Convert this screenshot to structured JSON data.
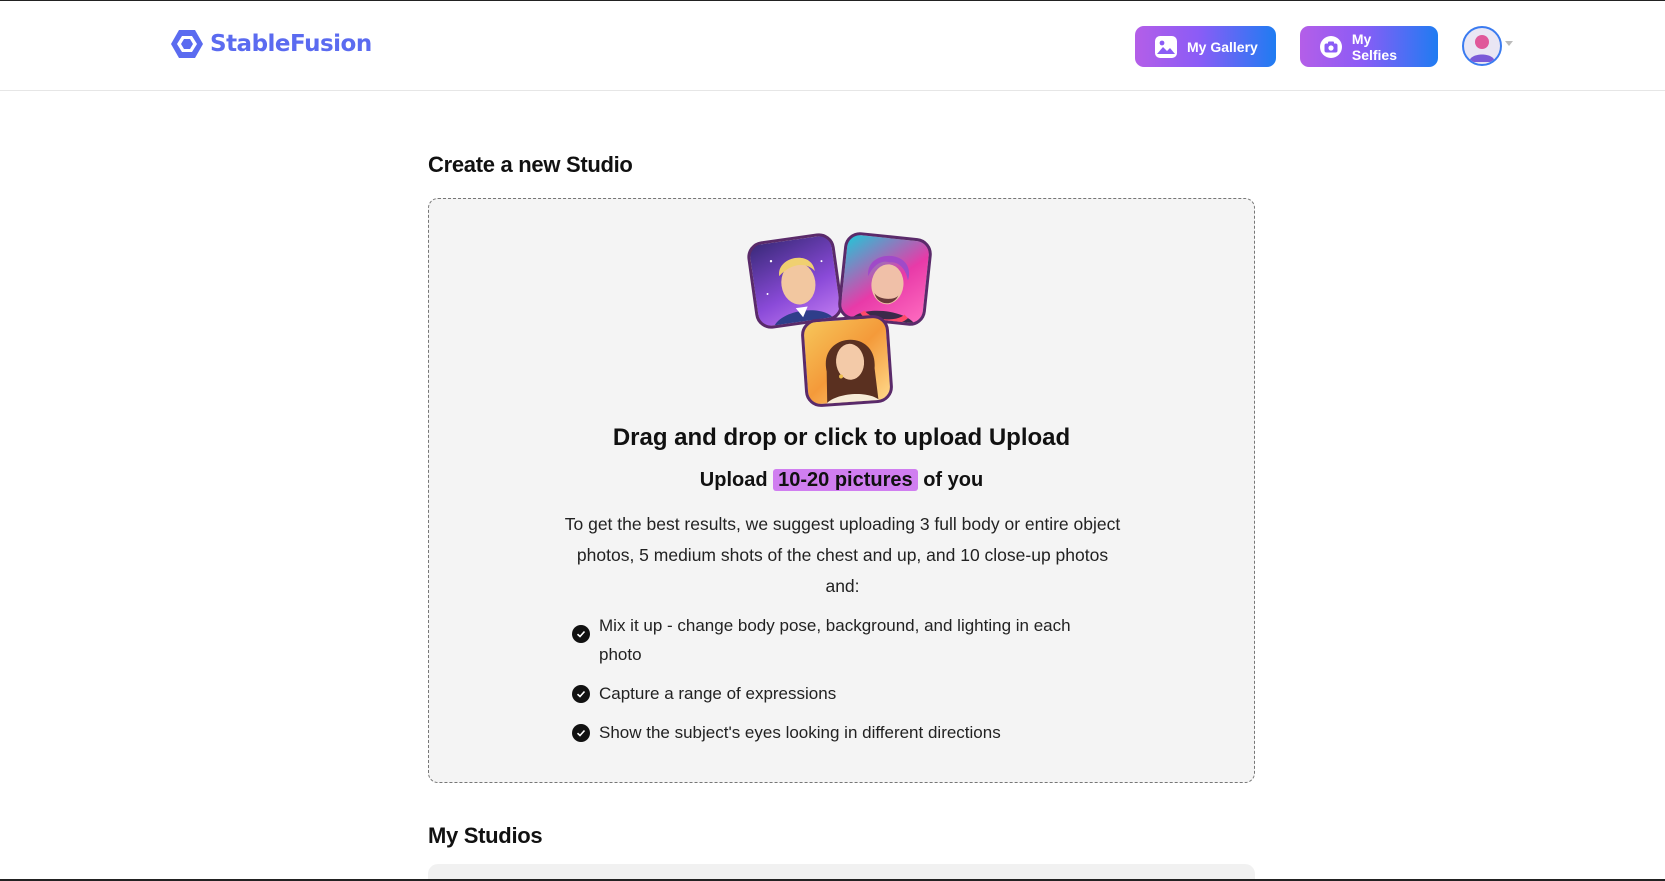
{
  "header": {
    "logo_text": "StableFusion",
    "gallery_label": "My Gallery",
    "selfies_label": "My Selfies",
    "accent_gradient": [
      "#b45ee8",
      "#1f7cf2"
    ],
    "logo_color": "#5b6bf0"
  },
  "create": {
    "title": "Create a new Studio",
    "upload_title": "Drag and drop or click to upload Upload",
    "upload_sub_before": "Upload",
    "upload_sub_highlight": "10-20 pictures",
    "upload_sub_after": "of you",
    "description": "To get the best results, we suggest uploading 3 full body or entire object photos, 5 medium shots of the chest and up, and 10 close-up photos and:",
    "tips": [
      "Mix it up - change body pose, background, and lighting in each photo",
      "Capture a range of expressions",
      "Show the subject's eyes looking in different directions"
    ],
    "highlight_color": "#d07ef0"
  },
  "studios": {
    "title": "My Studios"
  }
}
